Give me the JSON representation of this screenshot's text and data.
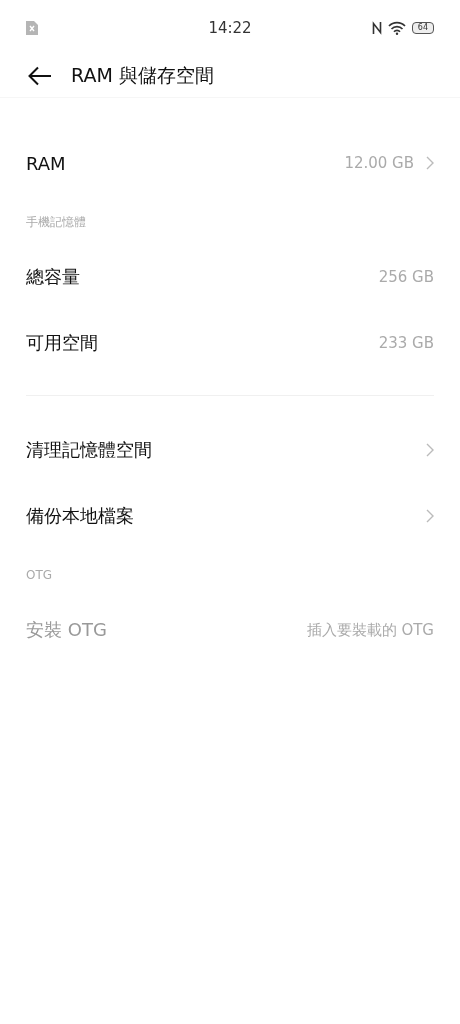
{
  "status_bar": {
    "time": "14:22",
    "battery": "64"
  },
  "header": {
    "title": "RAM 與儲存空間"
  },
  "groups": [
    {
      "items": [
        {
          "kind": "row",
          "label": "RAM",
          "value": "12.00 GB",
          "chevron": true,
          "disabled": false
        },
        {
          "kind": "header",
          "label": "手機記憶體"
        },
        {
          "kind": "row",
          "label": "總容量",
          "value": "256 GB",
          "chevron": false,
          "disabled": false
        },
        {
          "kind": "row",
          "label": "可用空間",
          "value": "233 GB",
          "chevron": false,
          "disabled": false
        }
      ]
    },
    {
      "items": [
        {
          "kind": "row",
          "label": "清理記憶體空間",
          "chevron": true,
          "disabled": false
        },
        {
          "kind": "row",
          "label": "備份本地檔案",
          "chevron": true,
          "disabled": false
        },
        {
          "kind": "header",
          "label": "OTG"
        },
        {
          "kind": "row",
          "label": "安裝 OTG",
          "value": "插入要裝載的 OTG",
          "chevron": false,
          "disabled": true
        }
      ]
    }
  ]
}
